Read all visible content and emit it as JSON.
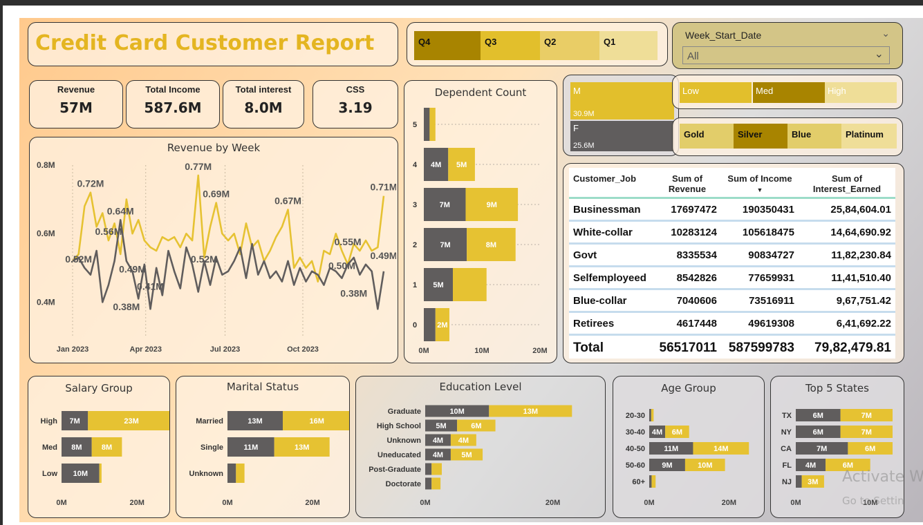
{
  "report_title": "Credit Card Customer Report",
  "colors": {
    "yellow": "#e6c232",
    "dark": "#605d5d",
    "gold_dark": "#a88400",
    "gold_light": "#ead88a"
  },
  "quarter_slicer": [
    "Q4",
    "Q3",
    "Q2",
    "Q1"
  ],
  "week_slicer": {
    "label": "Week_Start_Date",
    "value": "All"
  },
  "income_slicer": [
    "Low",
    "Med",
    "High"
  ],
  "card_slicer": [
    "Gold",
    "Silver",
    "Blue",
    "Platinum"
  ],
  "kpis": [
    {
      "label": "Revenue",
      "value": "57M"
    },
    {
      "label": "Total Income",
      "value": "587.6M"
    },
    {
      "label": "Total interest",
      "value": "8.0M"
    },
    {
      "label": "CSS",
      "value": "3.19"
    }
  ],
  "gender_treemap": {
    "m_label": "M",
    "m_value": "30.9M",
    "f_label": "F",
    "f_value": "25.6M"
  },
  "customer_table": {
    "headers": [
      "Customer_Job",
      "Sum of Revenue",
      "Sum of Income",
      "Sum of Interest_Earned"
    ],
    "rows": [
      [
        "Businessman",
        "17697472",
        "190350431",
        "25,84,604.01"
      ],
      [
        "White-collar",
        "10283124",
        "105618475",
        "14,64,690.92"
      ],
      [
        "Govt",
        "8335534",
        "90834727",
        "11,82,230.84"
      ],
      [
        "Selfemployeed",
        "8542826",
        "77659931",
        "11,41,510.40"
      ],
      [
        "Blue-collar",
        "7040606",
        "73516911",
        "9,67,751.42"
      ],
      [
        "Retirees",
        "4617448",
        "49619308",
        "6,41,692.22"
      ]
    ],
    "total": [
      "Total",
      "56517011",
      "587599783",
      "79,82,479.81"
    ]
  },
  "watermark": {
    "line1": "Activate W",
    "line2": "Go to Settin"
  },
  "chart_data": [
    {
      "type": "line",
      "title": "Revenue by Week",
      "xlabel": "",
      "ylabel": "",
      "ylim": [
        0.3,
        0.8
      ],
      "yticks": [
        "0.4M",
        "0.6M",
        "0.8M"
      ],
      "xticks": [
        "Jan 2023",
        "Apr 2023",
        "Jul 2023",
        "Oct 2023"
      ],
      "series": [
        {
          "color": "#e6c232",
          "values": [
            0.52,
            0.54,
            0.68,
            0.72,
            0.62,
            0.66,
            0.58,
            0.63,
            0.54,
            0.7,
            0.6,
            0.64,
            0.58,
            0.56,
            0.55,
            0.59,
            0.58,
            0.59,
            0.56,
            0.6,
            0.58,
            0.77,
            0.53,
            0.62,
            0.69,
            0.6,
            0.58,
            0.6,
            0.54,
            0.63,
            0.56,
            0.58,
            0.52,
            0.55,
            0.59,
            0.62,
            0.67,
            0.5,
            0.53,
            0.5,
            0.52,
            0.46,
            0.55,
            0.54,
            0.6,
            0.55,
            0.51,
            0.57,
            0.55,
            0.58,
            0.55,
            0.56,
            0.71
          ]
        },
        {
          "color": "#605d5d",
          "values": [
            0.52,
            0.53,
            0.5,
            0.48,
            0.55,
            0.4,
            0.45,
            0.52,
            0.64,
            0.52,
            0.49,
            0.41,
            0.51,
            0.38,
            0.5,
            0.42,
            0.55,
            0.49,
            0.44,
            0.56,
            0.51,
            0.43,
            0.52,
            0.45,
            0.53,
            0.48,
            0.49,
            0.52,
            0.56,
            0.47,
            0.57,
            0.48,
            0.52,
            0.47,
            0.49,
            0.46,
            0.52,
            0.45,
            0.5,
            0.46,
            0.49,
            0.48,
            0.45,
            0.5,
            0.49,
            0.47,
            0.51,
            0.53,
            0.48,
            0.51,
            0.49,
            0.38,
            0.49
          ]
        }
      ],
      "annotations": [
        {
          "text": "0.72M",
          "i": 3,
          "v": 0.72
        },
        {
          "text": "0.64M",
          "i": 8,
          "v": 0.64
        },
        {
          "text": "0.77M",
          "i": 21,
          "v": 0.77
        },
        {
          "text": "0.69M",
          "i": 24,
          "v": 0.69
        },
        {
          "text": "0.67M",
          "i": 36,
          "v": 0.67
        },
        {
          "text": "0.71M",
          "i": 52,
          "v": 0.71
        },
        {
          "text": "0.56M",
          "i": 6,
          "v": 0.58
        },
        {
          "text": "0.55M",
          "i": 46,
          "v": 0.55
        },
        {
          "text": "0.49M",
          "i": 52,
          "v": 0.51
        },
        {
          "text": "0.52M",
          "i": 1,
          "v": 0.5
        },
        {
          "text": "0.49M",
          "i": 10,
          "v": 0.47
        },
        {
          "text": "0.52M",
          "i": 22,
          "v": 0.5
        },
        {
          "text": "0.50M",
          "i": 45,
          "v": 0.48
        },
        {
          "text": "0.41M",
          "i": 13,
          "v": 0.42
        },
        {
          "text": "0.38M",
          "i": 9,
          "v": 0.36
        },
        {
          "text": "0.38M",
          "i": 47,
          "v": 0.4
        }
      ]
    },
    {
      "type": "bar",
      "title": "Dependent Count",
      "orientation": "vertical-stacked",
      "categories": [
        "5",
        "4",
        "3",
        "2",
        "1",
        "0"
      ],
      "xticks": [
        "0M",
        "10M",
        "20M"
      ],
      "xlim": [
        0,
        20
      ],
      "series": [
        {
          "color": "#605d5d",
          "values": [
            1.0,
            4.2,
            7.2,
            7.4,
            5.0,
            2.0
          ],
          "labels": [
            "",
            "4M",
            "7M",
            "7M",
            "5M",
            ""
          ]
        },
        {
          "color": "#e6c232",
          "values": [
            1.0,
            4.6,
            9.0,
            8.4,
            5.8,
            2.4
          ],
          "labels": [
            "",
            "5M",
            "9M",
            "8M",
            "",
            "2M"
          ]
        }
      ]
    },
    {
      "type": "bar",
      "title": "Salary Group",
      "categories": [
        "High",
        "Med",
        "Low"
      ],
      "xticks": [
        "0M",
        "20M"
      ],
      "xlim": [
        0,
        26
      ],
      "series": [
        {
          "color": "#605d5d",
          "values": [
            7,
            8,
            10
          ],
          "labels": [
            "7M",
            "8M",
            "10M"
          ]
        },
        {
          "color": "#e6c232",
          "values": [
            23,
            8,
            0.6
          ],
          "labels": [
            "23M",
            "8M",
            ""
          ]
        }
      ]
    },
    {
      "type": "bar",
      "title": "Marital Status",
      "categories": [
        "Married",
        "Single",
        "Unknown"
      ],
      "xticks": [
        "0M",
        "20M"
      ],
      "xlim": [
        0,
        26
      ],
      "series": [
        {
          "color": "#605d5d",
          "values": [
            13,
            11,
            2
          ],
          "labels": [
            "13M",
            "11M",
            ""
          ]
        },
        {
          "color": "#e6c232",
          "values": [
            16,
            13,
            2
          ],
          "labels": [
            "16M",
            "13M",
            ""
          ]
        }
      ]
    },
    {
      "type": "bar",
      "title": "Education Level",
      "categories": [
        "Graduate",
        "High School",
        "Unknown",
        "Uneducated",
        "Post-Graduate",
        "Doctorate"
      ],
      "xticks": [
        "0M",
        "20M"
      ],
      "xlim": [
        0,
        26
      ],
      "series": [
        {
          "color": "#605d5d",
          "values": [
            10,
            5,
            4,
            4,
            1,
            1
          ],
          "labels": [
            "10M",
            "5M",
            "4M",
            "4M",
            "",
            ""
          ]
        },
        {
          "color": "#e6c232",
          "values": [
            13,
            6,
            4,
            5,
            1.6,
            1.4
          ],
          "labels": [
            "13M",
            "6M",
            "4M",
            "5M",
            "",
            ""
          ]
        }
      ]
    },
    {
      "type": "bar",
      "title": "Age Group",
      "categories": [
        "20-30",
        "30-40",
        "40-50",
        "50-60",
        "60+"
      ],
      "xticks": [
        "0M",
        "20M"
      ],
      "xlim": [
        0,
        26
      ],
      "series": [
        {
          "color": "#605d5d",
          "values": [
            0.5,
            4,
            11,
            9,
            0.6
          ],
          "labels": [
            "",
            "4M",
            "11M",
            "9M",
            ""
          ]
        },
        {
          "color": "#e6c232",
          "values": [
            0.6,
            6,
            14,
            10,
            1
          ],
          "labels": [
            "",
            "6M",
            "14M",
            "10M",
            ""
          ]
        }
      ]
    },
    {
      "type": "bar",
      "title": "Top 5 States",
      "categories": [
        "TX",
        "NY",
        "CA",
        "FL",
        "NJ"
      ],
      "xticks": [
        "0M",
        "10M"
      ],
      "xlim": [
        0,
        13
      ],
      "series": [
        {
          "color": "#605d5d",
          "values": [
            6,
            6,
            7,
            4,
            0.8
          ],
          "labels": [
            "6M",
            "6M",
            "7M",
            "4M",
            ""
          ]
        },
        {
          "color": "#e6c232",
          "values": [
            7,
            7,
            6,
            6,
            3
          ],
          "labels": [
            "7M",
            "7M",
            "6M",
            "6M",
            "3M"
          ]
        }
      ]
    }
  ]
}
